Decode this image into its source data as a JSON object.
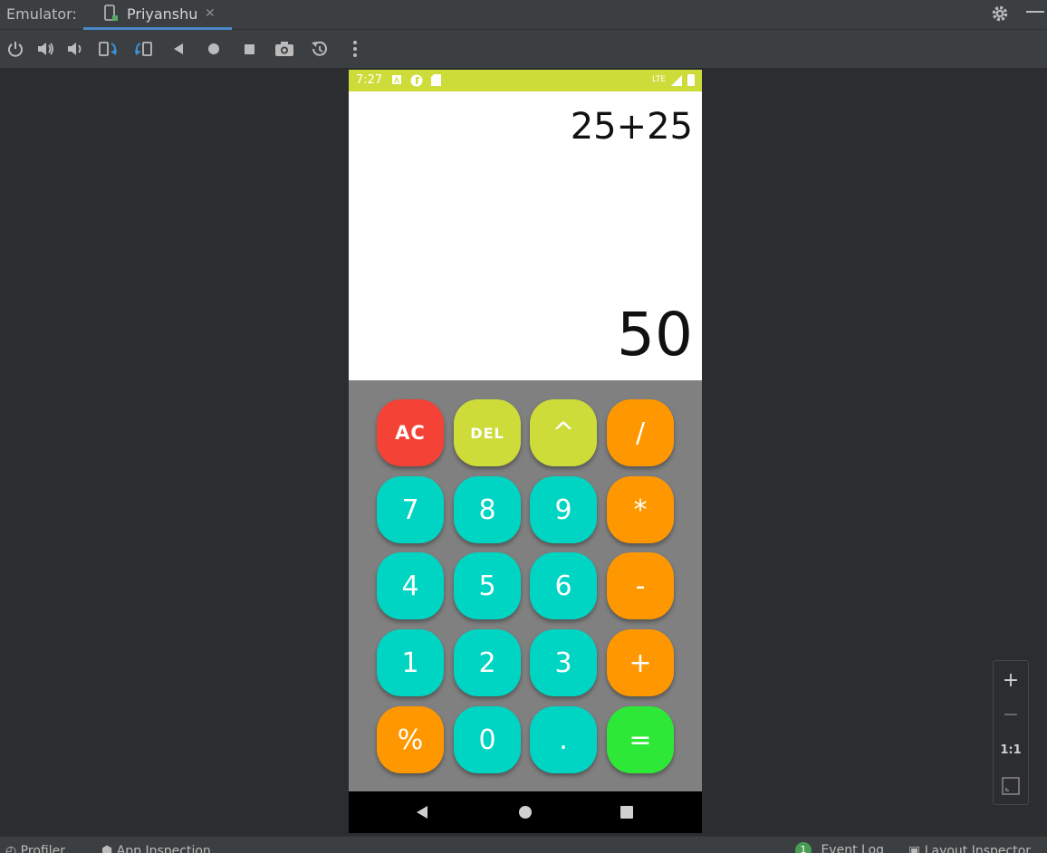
{
  "ide": {
    "emulator_label": "Emulator:",
    "device_tab": "Priyanshu",
    "close_glyph": "✕",
    "toolbar_icons": [
      "power-icon",
      "volume-up-icon",
      "volume-down-icon",
      "rotate-left-icon",
      "rotate-right-icon",
      "back-icon",
      "home-icon",
      "overview-icon",
      "camera-icon",
      "snapshot-icon",
      "more-icon"
    ],
    "zoom": {
      "plus": "+",
      "minus": "−",
      "one_to_one": "1:1"
    },
    "bottom_bar": {
      "profiler": "Profiler",
      "app_inspection": "App Inspection",
      "event_log_badge": "1",
      "event_log": "Event Log",
      "layout_inspector": "Layout Inspector"
    }
  },
  "phone": {
    "status": {
      "time": "7:27",
      "network": "LTE"
    },
    "display": {
      "expression": "25+25",
      "result": "50"
    },
    "keys": [
      [
        "AC",
        "DEL",
        "^",
        "/"
      ],
      [
        "7",
        "8",
        "9",
        "*"
      ],
      [
        "4",
        "5",
        "6",
        "-"
      ],
      [
        "1",
        "2",
        "3",
        "+"
      ],
      [
        "%",
        "0",
        ".",
        "="
      ]
    ],
    "colors": {
      "status_bar": "#cddc39",
      "clear": "#f44336",
      "delete_power": "#cddc39",
      "operator": "#ff9800",
      "digit": "#00d4c2",
      "equals": "#2ee838",
      "keypad_bg": "#808080"
    }
  }
}
